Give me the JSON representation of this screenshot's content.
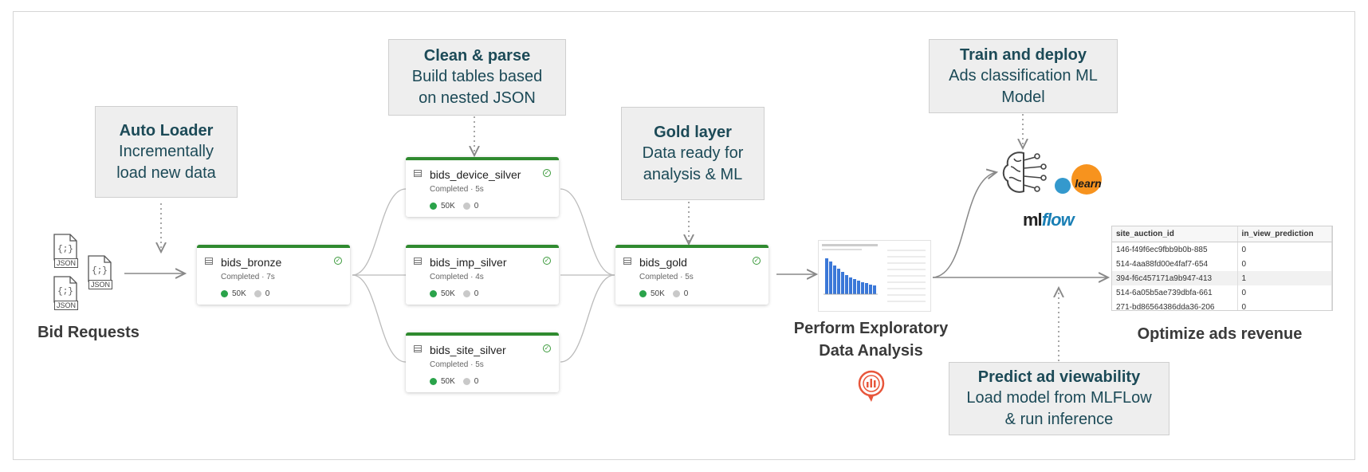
{
  "callouts": {
    "autoloader": {
      "title": "Auto Loader",
      "desc": "Incrementally\nload new data"
    },
    "clean": {
      "title": "Clean & parse",
      "desc": "Build tables based\non nested JSON"
    },
    "gold": {
      "title": "Gold layer",
      "desc": "Data ready for\nanalysis & ML"
    },
    "train": {
      "title": "Train and deploy",
      "desc": "Ads classification ML\nModel"
    },
    "predict": {
      "title": "Predict ad viewability",
      "desc": "Load model from MLFLow\n& run inference"
    }
  },
  "nodes": {
    "bronze": {
      "name": "bids_bronze",
      "status": "Completed · 7s",
      "ok": "50K",
      "fail": "0"
    },
    "device": {
      "name": "bids_device_silver",
      "status": "Completed · 5s",
      "ok": "50K",
      "fail": "0"
    },
    "imp": {
      "name": "bids_imp_silver",
      "status": "Completed · 4s",
      "ok": "50K",
      "fail": "0"
    },
    "site": {
      "name": "bids_site_silver",
      "status": "Completed · 5s",
      "ok": "50K",
      "fail": "0"
    },
    "gold": {
      "name": "bids_gold",
      "status": "Completed · 5s",
      "ok": "50K",
      "fail": "0"
    }
  },
  "labels": {
    "bid_requests": "Bid Requests",
    "eda": "Perform Exploratory\nData Analysis",
    "optimize": "Optimize ads revenue",
    "json_icon": "JSON",
    "sklearn": "learn",
    "mlflow_ml": "ml",
    "mlflow_flow": "flow"
  },
  "result_table": {
    "headers": [
      "site_auction_id",
      "in_view_prediction"
    ],
    "rows": [
      [
        "146-f49f6ec9fbb9b0b-885",
        "0"
      ],
      [
        "514-4aa88fd00e4faf7-654",
        "0"
      ],
      [
        "394-f6c457171a9b947-413",
        "1"
      ],
      [
        "514-6a05b5ae739dbfa-661",
        "0"
      ],
      [
        "271-bd86564386dda36-206",
        "0"
      ]
    ]
  },
  "icons": [
    "json-file-icon",
    "brain-icon",
    "sklearn-logo-icon",
    "mlflow-logo-icon",
    "eda-chart-icon",
    "redash-icon"
  ],
  "colors": {
    "accent_teal": "#1c4a57",
    "node_green": "#2f8a2f",
    "success_dot": "#2aa34a",
    "redash": "#e8563b"
  }
}
